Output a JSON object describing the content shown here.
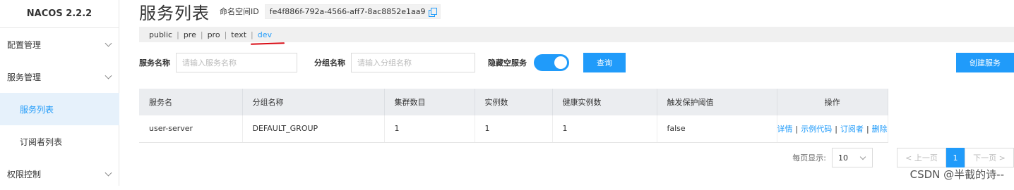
{
  "brand": "NACOS 2.2.2",
  "sidebar": {
    "items": [
      {
        "label": "配置管理"
      },
      {
        "label": "服务管理"
      },
      {
        "label": "服务列表"
      },
      {
        "label": "订阅者列表"
      },
      {
        "label": "权限控制"
      }
    ]
  },
  "header": {
    "title": "服务列表",
    "namespace_label": "命名空间ID",
    "namespace_id": "fe4f886f-792a-4566-aff7-8ac8852e1aa9"
  },
  "namespaces": [
    "public",
    "pre",
    "pro",
    "text",
    "dev"
  ],
  "namespace_active": "dev",
  "filters": {
    "service_name_label": "服务名称",
    "service_name_placeholder": "请输入服务名称",
    "group_name_label": "分组名称",
    "group_name_placeholder": "请输入分组名称",
    "hide_empty_label": "隐藏空服务",
    "hide_empty_on": true,
    "query_button": "查询",
    "create_button": "创建服务"
  },
  "table": {
    "columns": [
      "服务名",
      "分组名称",
      "集群数目",
      "实例数",
      "健康实例数",
      "触发保护阈值",
      "操作"
    ],
    "rows": [
      {
        "service": "user-server",
        "group": "DEFAULT_GROUP",
        "clusters": "1",
        "instances": "1",
        "healthy": "1",
        "threshold": "false",
        "ops": [
          "详情",
          "示例代码",
          "订阅者",
          "删除"
        ]
      }
    ]
  },
  "pagination": {
    "page_size_label": "每页显示:",
    "page_size": "10",
    "prev": "< 上一页",
    "current": "1",
    "next": "下一页 >"
  },
  "watermark": "CSDN @半截的诗--",
  "colors": {
    "accent": "#209bfa",
    "annotation": "#d80b14"
  }
}
